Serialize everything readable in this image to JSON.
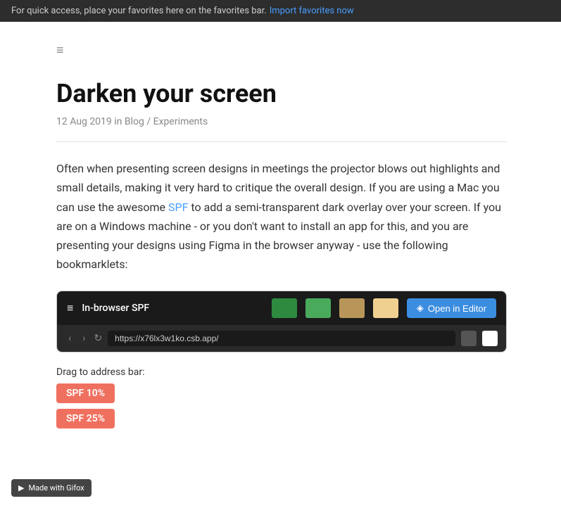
{
  "favorites_bar": {
    "message": "For quick access, place your favorites here on the favorites bar.",
    "link_text": "Import favorites now",
    "link_href": "#"
  },
  "menu_icon": "≡",
  "article": {
    "title": "Darken your screen",
    "meta_date": "12 Aug 2019",
    "meta_in": "in",
    "meta_category1": "Blog",
    "meta_separator": "/",
    "meta_category2": "Experiments",
    "body_part1": "Often when presenting screen designs in meetings the projector blows out highlights and small details, making it very hard to critique the overall design. If you are using a Mac you can use the awesome ",
    "spf_link": "SPF",
    "body_part2": " to add a semi-transparent dark overlay over your screen. If you are on a Windows machine - or you don't want to install an app for this, and you are presenting your designs using Figma in the browser anyway - use the following bookmarklets:"
  },
  "embed": {
    "menu_icon": "≡",
    "title": "In-browser SPF",
    "swatches": [
      {
        "color": "#2d8a3e",
        "label": "dark green"
      },
      {
        "color": "#4aaa5c",
        "label": "medium green"
      },
      {
        "color": "#b8965a",
        "label": "tan"
      },
      {
        "color": "#f0d090",
        "label": "light yellow"
      }
    ],
    "open_editor_icon": "◈",
    "open_editor_label": "Open in Editor",
    "nav_back": "‹",
    "nav_forward": "›",
    "nav_refresh": "↻",
    "url": "https://x76lx3w1ko.csb.app/"
  },
  "drag_section": {
    "label": "Drag to address bar:",
    "bookmarklets": [
      {
        "label": "SPF 10%",
        "class": "bookmarklet-spf10"
      },
      {
        "label": "SPF 25%",
        "class": "bookmarklet-spf25"
      }
    ]
  },
  "gifox_badge": {
    "icon": "▶",
    "label": "Made with Gifox"
  }
}
